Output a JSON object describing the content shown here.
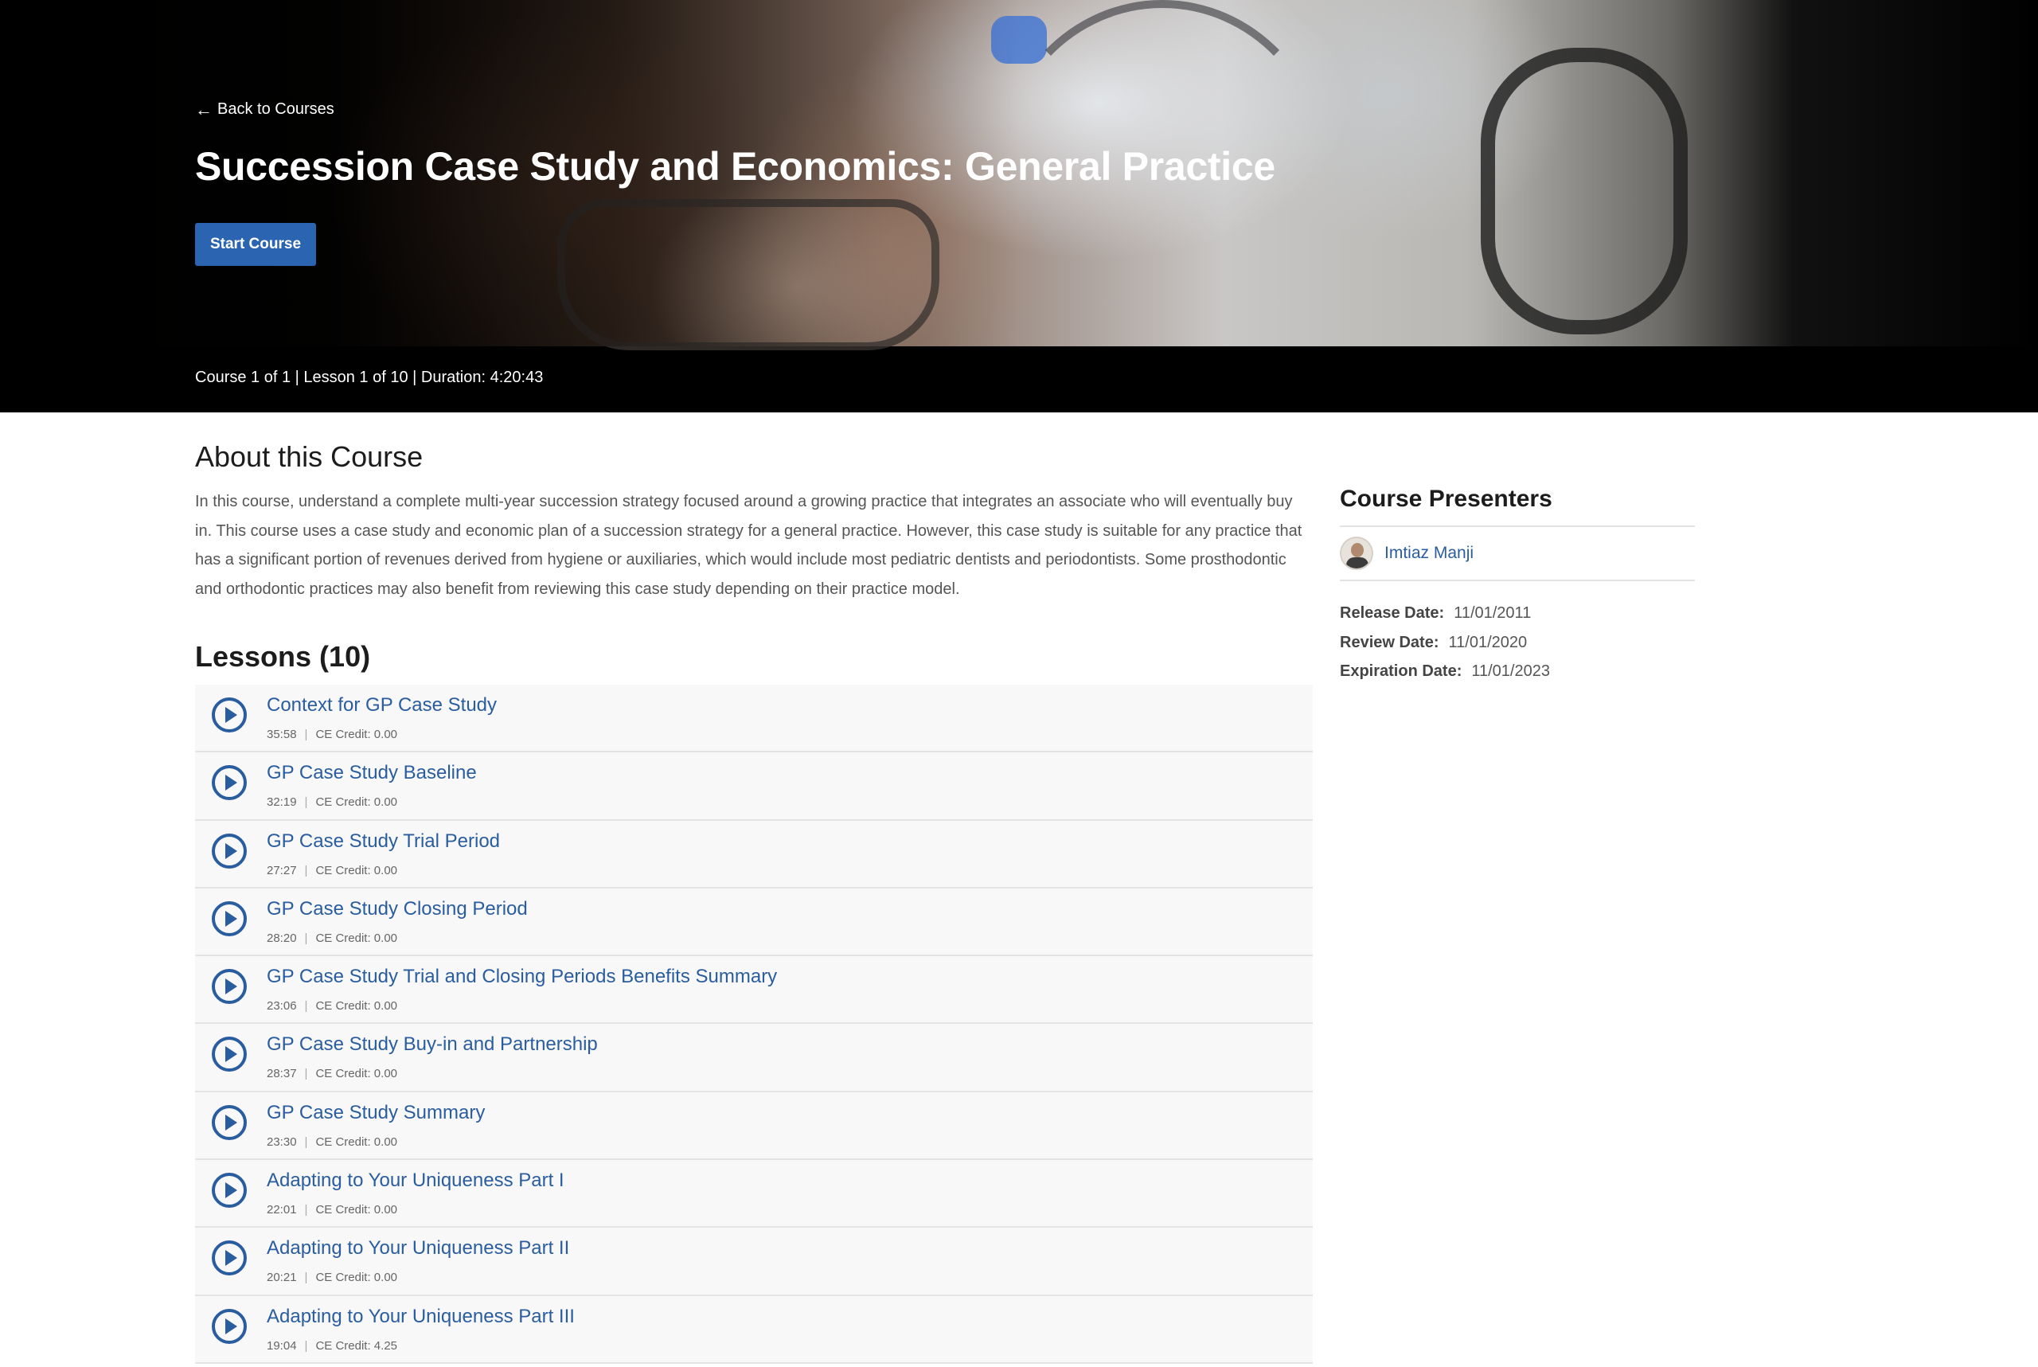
{
  "hero": {
    "back_label": "Back to Courses",
    "title": "Succession Case Study and Economics: General Practice",
    "start_label": "Start Course",
    "meta": "Course 1 of 1 | Lesson 1 of 10 | Duration: 4:20:43"
  },
  "about": {
    "heading": "About this Course",
    "text": "In this course, understand a complete multi-year succession strategy focused around a growing practice that integrates an associate who will eventually buy in. This course uses a case study and economic plan of a succession strategy for a general practice. However, this case study is suitable for any practice that has a significant portion of revenues derived from hygiene or auxiliaries, which would include most pediatric dentists and periodontists. Some prosthodontic and orthodontic practices may also benefit from reviewing this case study depending on their practice model."
  },
  "lessons": {
    "heading": "Lessons (10)",
    "items": [
      {
        "title": "Context for GP Case Study",
        "duration": "35:58",
        "credit": "CE Credit: 0.00"
      },
      {
        "title": "GP Case Study Baseline",
        "duration": "32:19",
        "credit": "CE Credit: 0.00"
      },
      {
        "title": "GP Case Study Trial Period",
        "duration": "27:27",
        "credit": "CE Credit: 0.00"
      },
      {
        "title": "GP Case Study Closing Period",
        "duration": "28:20",
        "credit": "CE Credit: 0.00"
      },
      {
        "title": "GP Case Study Trial and Closing Periods Benefits Summary",
        "duration": "23:06",
        "credit": "CE Credit: 0.00"
      },
      {
        "title": "GP Case Study Buy-in and Partnership",
        "duration": "28:37",
        "credit": "CE Credit: 0.00"
      },
      {
        "title": "GP Case Study Summary",
        "duration": "23:30",
        "credit": "CE Credit: 0.00"
      },
      {
        "title": "Adapting to Your Uniqueness Part I",
        "duration": "22:01",
        "credit": "CE Credit: 0.00"
      },
      {
        "title": "Adapting to Your Uniqueness Part II",
        "duration": "20:21",
        "credit": "CE Credit: 0.00"
      },
      {
        "title": "Adapting to Your Uniqueness Part III",
        "duration": "19:04",
        "credit": "CE Credit: 4.25"
      }
    ]
  },
  "sidebar": {
    "presenters_heading": "Course Presenters",
    "presenter_name": "Imtiaz Manji",
    "release_label": "Release Date:",
    "release_value": "11/01/2011",
    "review_label": "Review Date:",
    "review_value": "11/01/2020",
    "expiration_label": "Expiration Date:",
    "expiration_value": "11/01/2023"
  },
  "colors": {
    "accent": "#2b65b2",
    "link": "#2a5d9f",
    "hero_bg": "#000000"
  }
}
